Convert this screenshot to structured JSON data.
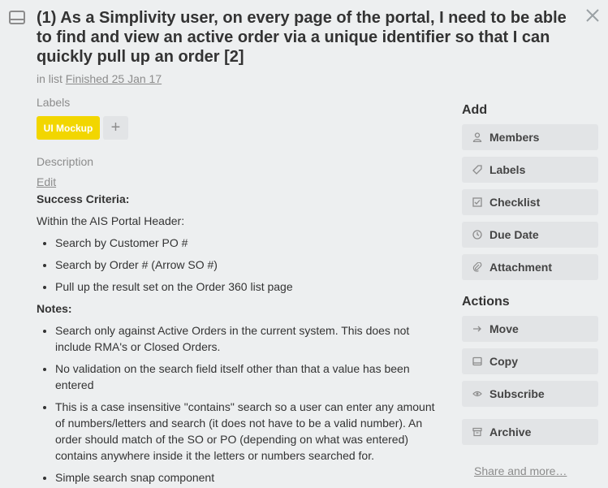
{
  "card": {
    "title": "(1) As a Simplivity user, on every page of the portal, I need to be able to find and view an active order via a unique identifier so that I can quickly pull up an order [2]",
    "in_list_prefix": "in list",
    "list_name": "Finished 25 Jan 17"
  },
  "labels": {
    "heading": "Labels",
    "items": [
      {
        "text": "UI Mockup",
        "color": "#f2d600"
      }
    ],
    "add_glyph": "+"
  },
  "description": {
    "heading": "Description",
    "edit_label": "Edit",
    "success_heading": "Success Criteria:",
    "intro": "Within the AIS Portal Header:",
    "criteria": [
      "Search by Customer PO #",
      "Search by Order # (Arrow SO #)",
      "Pull up the result set on the Order 360 list page"
    ],
    "notes_heading": "Notes:",
    "notes": [
      "Search only against Active Orders in the current system. This does not include RMA's or Closed Orders.",
      "No validation on the search field itself other than that a value has been entered",
      "This is a case insensitive \"contains\" search so a user can enter any amount of numbers/letters and search (it does not have to be a valid number). An order should match of the SO or PO (depending on what was entered) contains anywhere inside it the letters or numbers searched for.",
      "Simple search snap component"
    ]
  },
  "sidebar": {
    "add_heading": "Add",
    "add_buttons": [
      {
        "label": "Members",
        "icon": "person-icon"
      },
      {
        "label": "Labels",
        "icon": "tag-icon"
      },
      {
        "label": "Checklist",
        "icon": "checkbox-icon"
      },
      {
        "label": "Due Date",
        "icon": "clock-icon"
      },
      {
        "label": "Attachment",
        "icon": "paperclip-icon"
      }
    ],
    "actions_heading": "Actions",
    "action_buttons": [
      {
        "label": "Move",
        "icon": "arrow-right-icon"
      },
      {
        "label": "Copy",
        "icon": "card-icon"
      },
      {
        "label": "Subscribe",
        "icon": "eye-icon"
      },
      {
        "label": "Archive",
        "icon": "archive-icon"
      }
    ],
    "share_label": "Share and more…"
  }
}
